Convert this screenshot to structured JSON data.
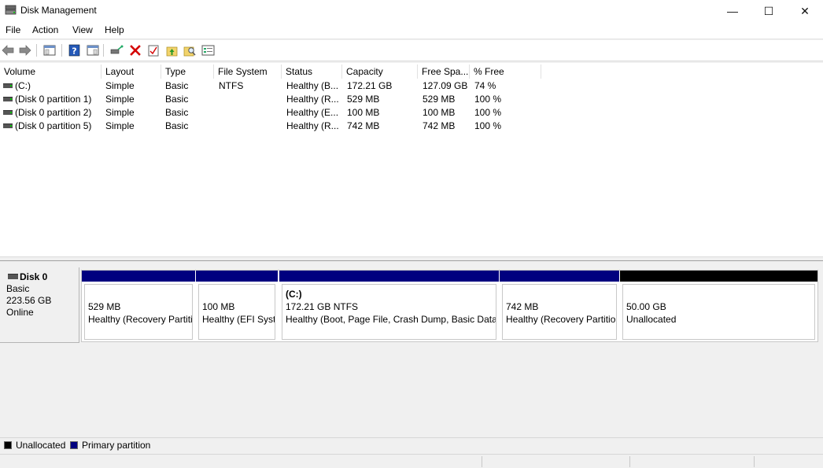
{
  "window": {
    "title": "Disk Management",
    "minimize_glyph": "—",
    "maximize_glyph": "☐",
    "close_glyph": "✕"
  },
  "menu": {
    "file": "File",
    "action": "Action",
    "view": "View",
    "help": "Help"
  },
  "toolbar": {
    "icons": [
      "back-arrow-icon",
      "forward-arrow-icon",
      "console-tree-icon",
      "help-icon",
      "properties-pane-icon",
      "connect-drive-icon",
      "delete-icon",
      "check-icon",
      "folder-up-icon",
      "search-folder-icon",
      "properties-icon"
    ],
    "delete_color": "#d40000"
  },
  "volume_list": {
    "columns": [
      "Volume",
      "Layout",
      "Type",
      "File System",
      "Status",
      "Capacity",
      "Free Spa...",
      "% Free"
    ],
    "rows": [
      {
        "volume": " (C:)",
        "layout": "Simple",
        "type": "Basic",
        "fs": "NTFS",
        "status": "Healthy (B...",
        "capacity": "172.21 GB",
        "free": "127.09 GB",
        "pct": "74 %"
      },
      {
        "volume": "(Disk 0 partition 1)",
        "layout": "Simple",
        "type": "Basic",
        "fs": "",
        "status": "Healthy (R...",
        "capacity": "529 MB",
        "free": "529 MB",
        "pct": "100 %"
      },
      {
        "volume": "(Disk 0 partition 2)",
        "layout": "Simple",
        "type": "Basic",
        "fs": "",
        "status": "Healthy (E...",
        "capacity": "100 MB",
        "free": "100 MB",
        "pct": "100 %"
      },
      {
        "volume": "(Disk 0 partition 5)",
        "layout": "Simple",
        "type": "Basic",
        "fs": "",
        "status": "Healthy (R...",
        "capacity": "742 MB",
        "free": "742 MB",
        "pct": "100 %"
      }
    ]
  },
  "disk": {
    "name": "Disk 0",
    "type": "Basic",
    "size": "223.56 GB",
    "state": "Online",
    "partitions": [
      {
        "name": "",
        "size": "529 MB",
        "status": "Healthy (Recovery Partition)",
        "kind": "primary"
      },
      {
        "name": "",
        "size": "100 MB",
        "status": "Healthy (EFI System Partition)",
        "kind": "primary"
      },
      {
        "name": "(C:)",
        "size": "172.21 GB NTFS",
        "status": "Healthy (Boot, Page File, Crash Dump, Basic Data Partition)",
        "kind": "primary"
      },
      {
        "name": "",
        "size": "742 MB",
        "status": "Healthy (Recovery Partition)",
        "kind": "primary"
      },
      {
        "name": "",
        "size": "50.00 GB",
        "status": "Unallocated",
        "kind": "unallocated"
      }
    ]
  },
  "legend": {
    "unallocated_label": "Unallocated",
    "unallocated_color": "#000000",
    "primary_label": "Primary partition",
    "primary_color": "#00007f"
  }
}
